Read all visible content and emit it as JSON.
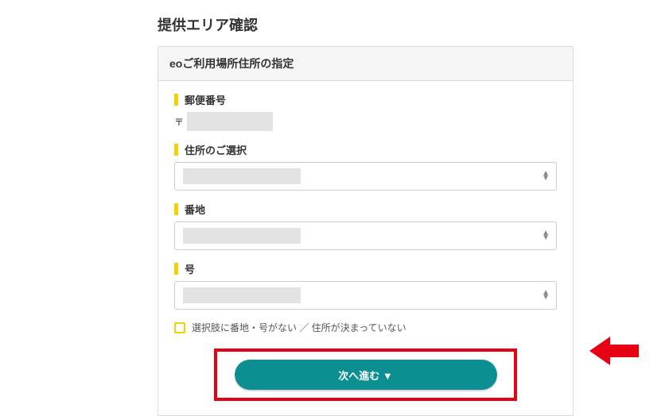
{
  "page": {
    "title": "提供エリア確認"
  },
  "card": {
    "heading": "eoご利用場所住所の指定"
  },
  "fields": {
    "postal": {
      "label": "郵便番号",
      "prefix": "〒",
      "value": ""
    },
    "address": {
      "label": "住所のご選択",
      "value": ""
    },
    "banchi": {
      "label": "番地",
      "value": ""
    },
    "gou": {
      "label": "号",
      "value": ""
    }
  },
  "checkbox": {
    "label": "選択肢に番地・号がない ／ 住所が決まっていない"
  },
  "button": {
    "next": "次へ進む ▼"
  }
}
